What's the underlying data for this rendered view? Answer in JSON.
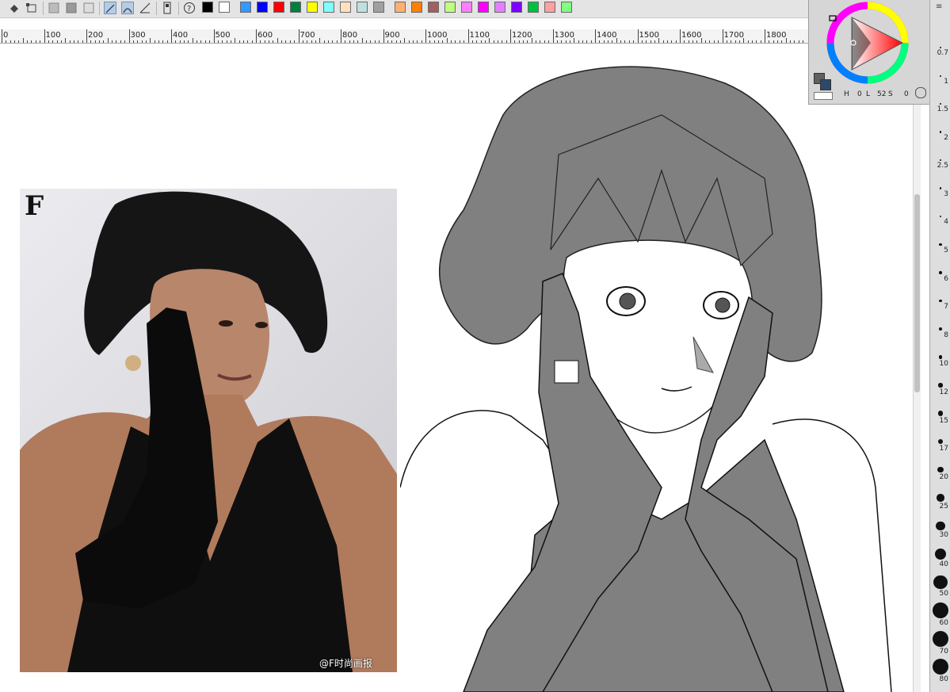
{
  "toolbar": {
    "icons": [
      "fill-bucket-icon",
      "transform-icon",
      "select-all-icon",
      "invert-selection-icon",
      "deselect-icon",
      "snap-ruler-icon",
      "snap-special-ruler-icon",
      "snap-grid-icon",
      "tablet-settings-icon",
      "help-icon"
    ],
    "palette": [
      "#000000",
      "#ffffff",
      "#3399ff",
      "#0000ff",
      "#ff0000",
      "#008040",
      "#ffff00",
      "#80ffff",
      "#ffe0c0",
      "#c0e0e0",
      "#a0a0a0",
      "#ffb070",
      "#ff8000",
      "#a06060",
      "#c0ff80",
      "#ff80ff",
      "#ff00ff",
      "#e080ff",
      "#8000ff",
      "#00c040",
      "#ffa0a0",
      "#80ff80"
    ]
  },
  "ruler": {
    "labels": [
      "0",
      "100",
      "200",
      "300",
      "400",
      "500",
      "600",
      "700",
      "800",
      "900",
      "1000",
      "1100",
      "1200",
      "1300",
      "1400",
      "1500",
      "1600",
      "1700",
      "1800"
    ]
  },
  "canvas": {
    "photo": {
      "logo": "F",
      "watermark": "@F时尚画报"
    }
  },
  "color_panel": {
    "hue_readout": "0",
    "saturation_readout": "0",
    "lightness_readout": "52",
    "extra_readout": "0",
    "h_label": "H",
    "s_label": "S",
    "l_label": "L"
  },
  "brush_panel": {
    "sizes": [
      "0.7",
      "1",
      "1.5",
      "2",
      "2.5",
      "3",
      "4",
      "5",
      "6",
      "7",
      "8",
      "10",
      "12",
      "15",
      "17",
      "20",
      "25",
      "30",
      "40",
      "50",
      "60",
      "70",
      "80"
    ]
  }
}
